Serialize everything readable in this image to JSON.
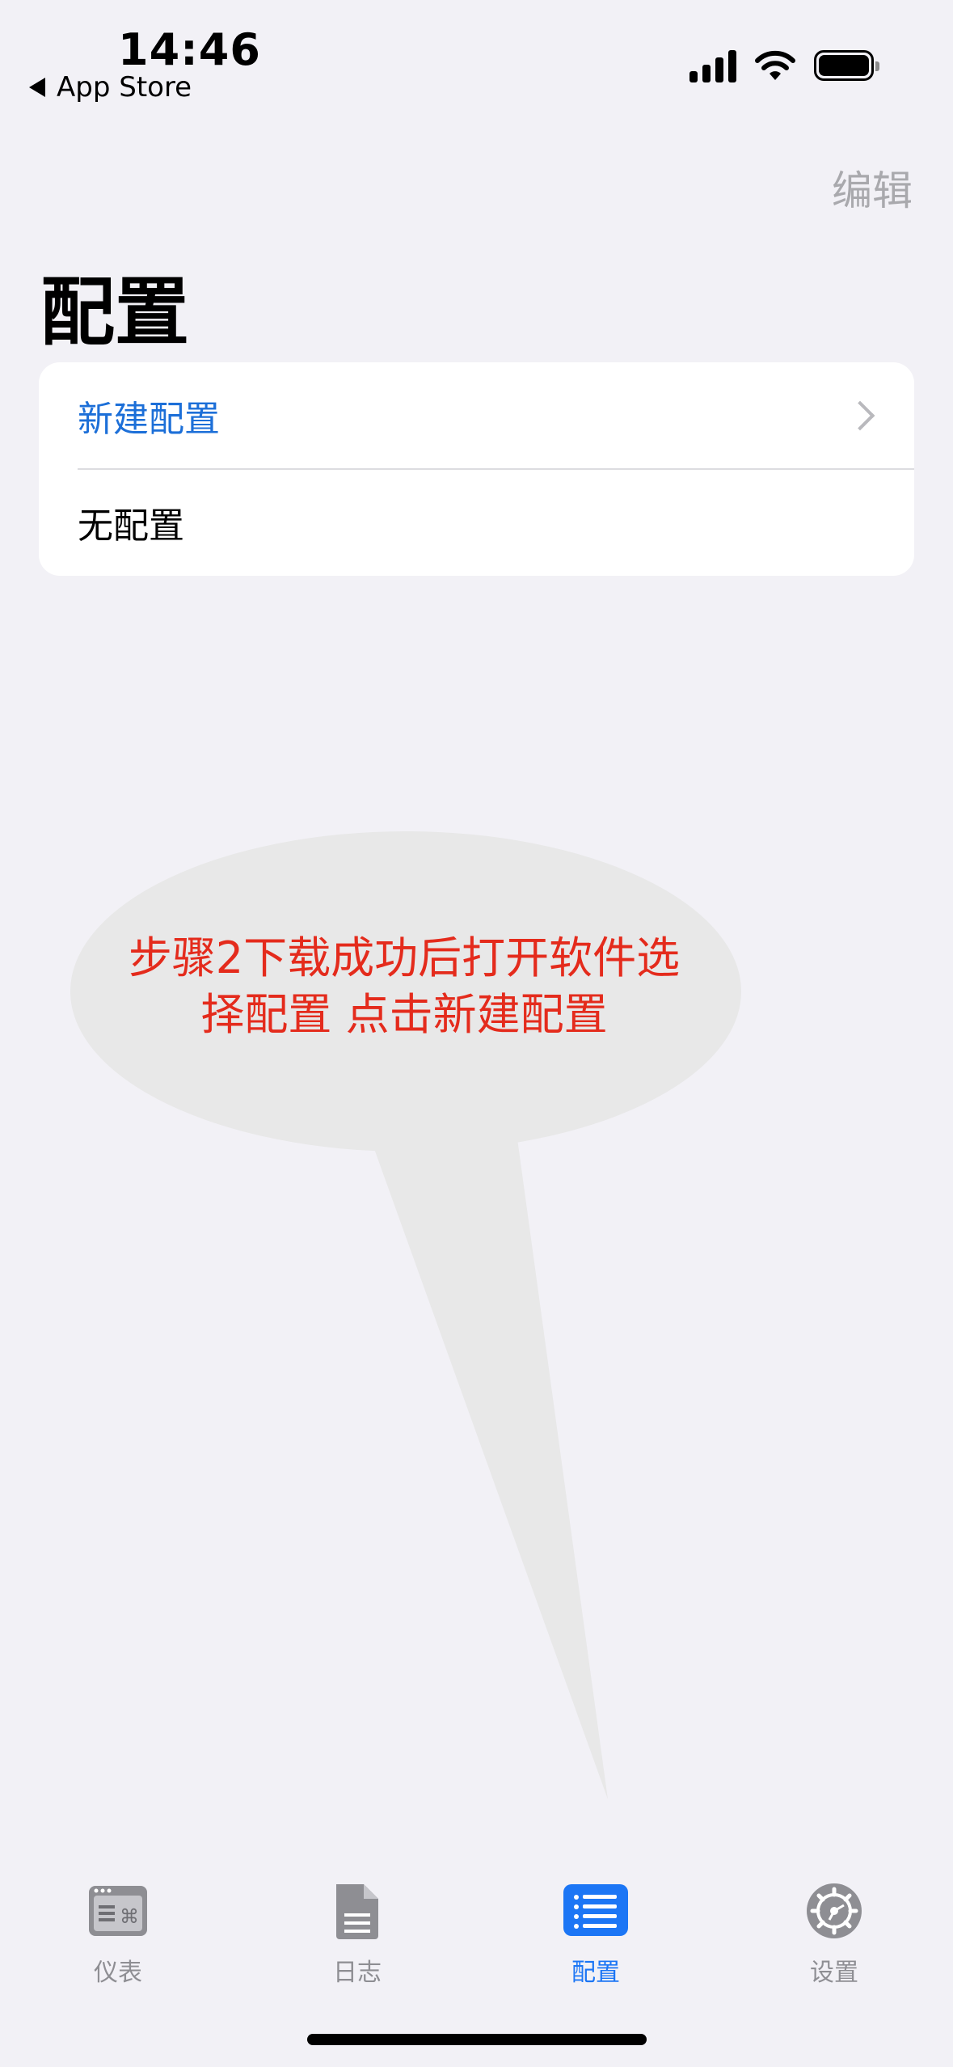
{
  "status_bar": {
    "time": "14:46",
    "back_app": "App Store"
  },
  "nav": {
    "edit_label": "编辑",
    "title": "配置"
  },
  "list": {
    "rows": [
      {
        "label": "新建配置"
      },
      {
        "label": "无配置"
      }
    ]
  },
  "annotation": {
    "line1": "步骤2下载成功后打开软件选",
    "line2": "择配置 点击新建配置"
  },
  "tab_bar": {
    "tabs": [
      {
        "label": "仪表",
        "icon": "dashboard-icon",
        "active": false
      },
      {
        "label": "日志",
        "icon": "document-icon",
        "active": false
      },
      {
        "label": "配置",
        "icon": "list-icon",
        "active": true
      },
      {
        "label": "设置",
        "icon": "gear-icon",
        "active": false
      }
    ]
  },
  "colors": {
    "accent": "#1c76f5",
    "annotation_text": "#e42b1c",
    "background": "#f2f1f6"
  }
}
